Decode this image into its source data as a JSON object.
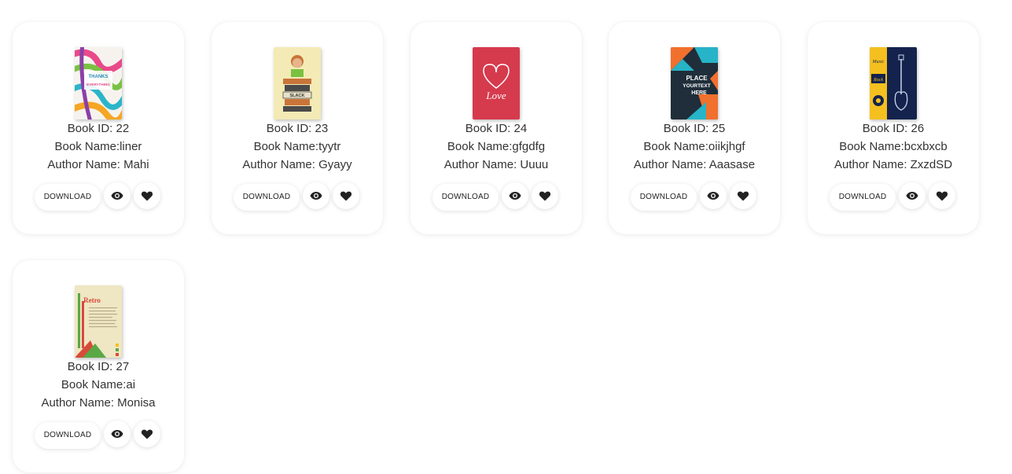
{
  "books": [
    {
      "id_text": "Book ID: 22",
      "name_text": "Book Name:liner",
      "author_text": "Author Name: Mahi",
      "download_label": "DOWNLOAD",
      "cover": {
        "kind": "thanks",
        "title_lines": [
          "THANKS",
          "EVERYTHING"
        ],
        "colors": [
          "#e84a8a",
          "#7ac142",
          "#f5a623",
          "#2bb5c9"
        ]
      },
      "view_icon": "eye-icon",
      "like_icon": "heart-icon"
    },
    {
      "id_text": "Book ID: 23",
      "name_text": "Book Name:tyytr",
      "author_text": "Author Name: Gyayy",
      "download_label": "DOWNLOAD",
      "cover": {
        "kind": "kid",
        "title_lines": [
          "SLACK"
        ],
        "colors": [
          "#f3eab5",
          "#c9743a",
          "#4a4a4a"
        ]
      },
      "view_icon": "eye-icon",
      "like_icon": "heart-icon"
    },
    {
      "id_text": "Book ID: 24",
      "name_text": "Book Name:gfgdfg",
      "author_text": "Author Name: Uuuu",
      "download_label": "DOWNLOAD",
      "cover": {
        "kind": "love",
        "title_lines": [
          "Love"
        ],
        "colors": [
          "#d63a4d",
          "#ffffff"
        ]
      },
      "view_icon": "eye-icon",
      "like_icon": "heart-icon"
    },
    {
      "id_text": "Book ID: 25",
      "name_text": "Book Name:oiikjhgf",
      "author_text": "Author Name: Aaasase",
      "download_label": "DOWNLOAD",
      "cover": {
        "kind": "place",
        "title_lines": [
          "PLACE",
          "YOURTEXT",
          "HERE"
        ],
        "colors": [
          "#1f2e3a",
          "#f2702e",
          "#27b3c8"
        ]
      },
      "view_icon": "eye-icon",
      "like_icon": "heart-icon"
    },
    {
      "id_text": "Book ID: 26",
      "name_text": "Book Name:bcxbxcb",
      "author_text": "Author Name: ZxzdSD",
      "download_label": "DOWNLOAD",
      "cover": {
        "kind": "music",
        "title_lines": [
          "Music",
          "Rock"
        ],
        "colors": [
          "#14234d",
          "#f4c020"
        ]
      },
      "view_icon": "eye-icon",
      "like_icon": "heart-icon"
    },
    {
      "id_text": "Book ID: 27",
      "name_text": "Book Name:ai",
      "author_text": "Author Name: Monisa",
      "download_label": "DOWNLOAD",
      "cover": {
        "kind": "retro",
        "title_lines": [
          "Retro"
        ],
        "colors": [
          "#efe6c3",
          "#d84a3a",
          "#5aa845"
        ]
      },
      "view_icon": "eye-icon",
      "like_icon": "heart-icon"
    }
  ]
}
